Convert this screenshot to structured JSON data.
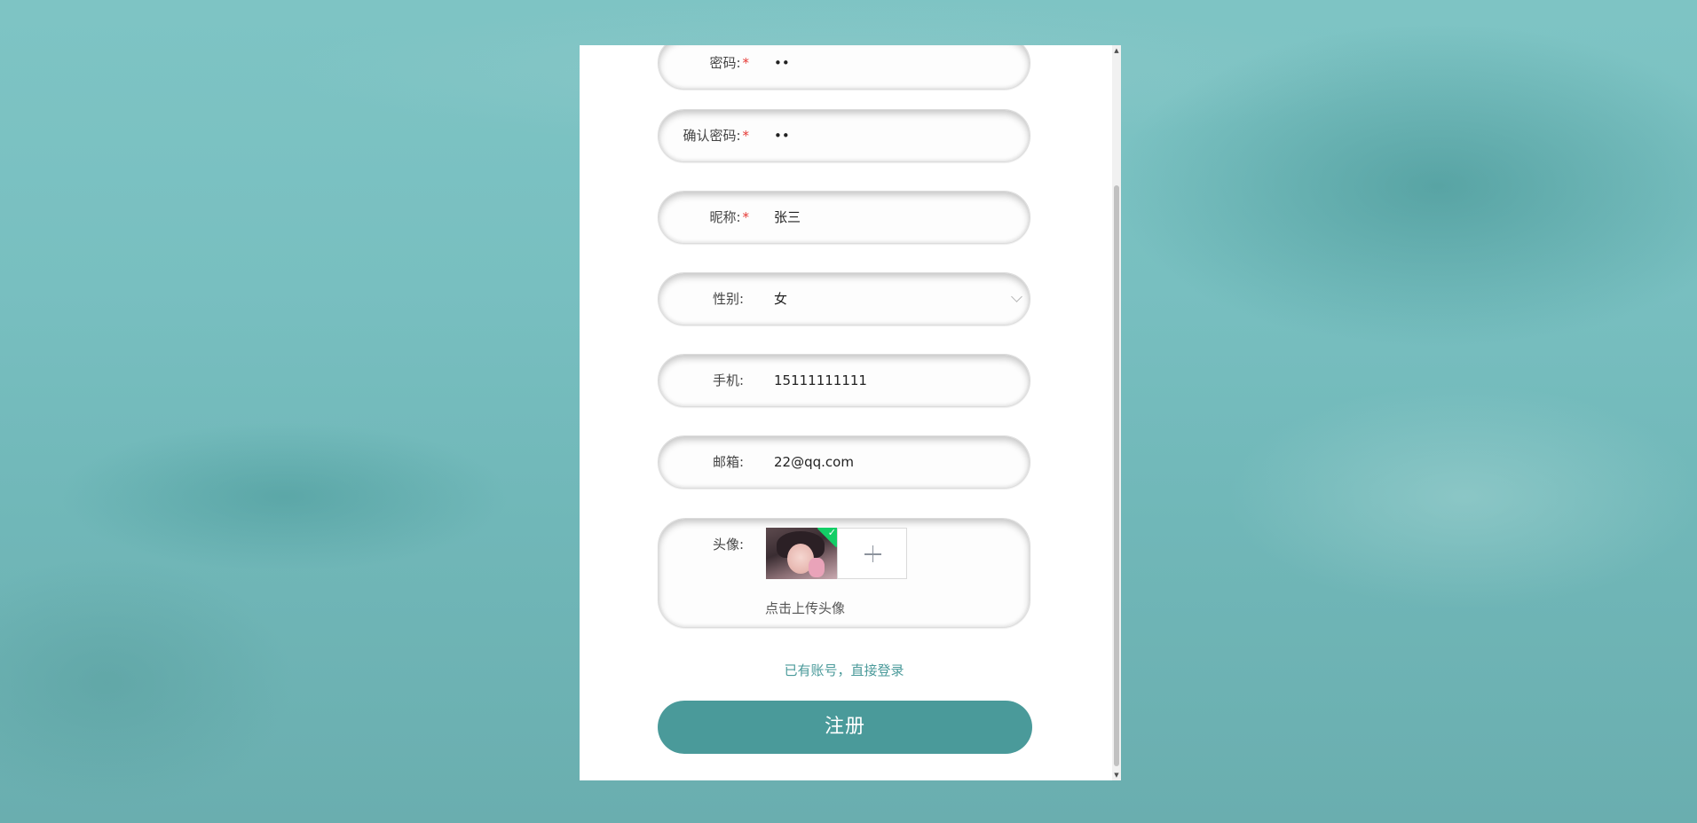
{
  "form": {
    "password": {
      "label": "密码:",
      "required": "*",
      "value": "••"
    },
    "confirm_password": {
      "label": "确认密码:",
      "required": "*",
      "value": "••"
    },
    "nickname": {
      "label": "昵称:",
      "required": "*",
      "value": "张三"
    },
    "gender": {
      "label": "性别:",
      "value": "女"
    },
    "phone": {
      "label": "手机:",
      "value": "15111111111"
    },
    "email": {
      "label": "邮箱:",
      "value": "22@qq.com"
    },
    "avatar": {
      "label": "头像:",
      "hint": "点击上传头像",
      "uploaded_icon": "check-icon",
      "add_icon": "plus-icon"
    }
  },
  "login_link": "已有账号，直接登录",
  "register_button": "注册",
  "colors": {
    "accent": "#4a9a9a",
    "required": "#e53935",
    "upload_success": "#13ce66"
  }
}
